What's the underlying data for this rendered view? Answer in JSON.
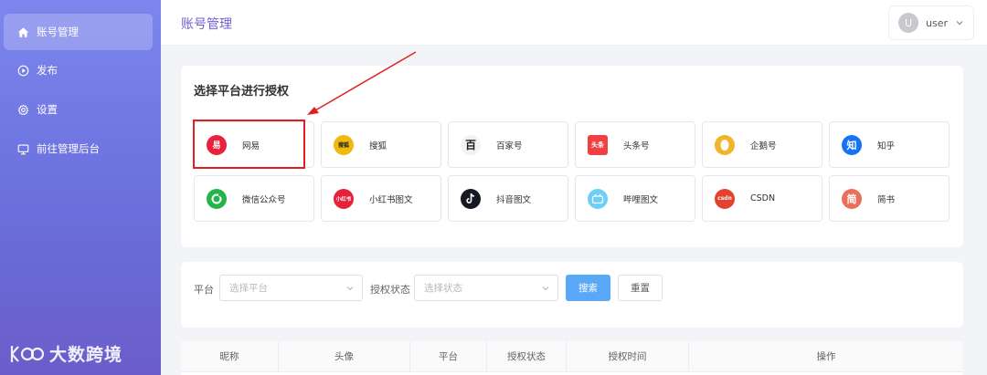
{
  "sidebar": {
    "items": [
      {
        "label": "账号管理",
        "icon": "home-icon",
        "active": true
      },
      {
        "label": "发布",
        "icon": "play-circle-icon",
        "active": false
      },
      {
        "label": "设置",
        "icon": "gear-icon",
        "active": false
      },
      {
        "label": "前往管理后台",
        "icon": "monitor-icon",
        "active": false
      }
    ],
    "watermark": "大数跨境"
  },
  "header": {
    "title": "账号管理",
    "user": {
      "avatar_letter": "U",
      "name": "user"
    }
  },
  "platforms": {
    "title": "选择平台进行授权",
    "items": [
      {
        "label": "网易",
        "icon_text": "易",
        "color": "#e8223a"
      },
      {
        "label": "搜狐",
        "icon_text": "搜狐",
        "color": "#f2b90f"
      },
      {
        "label": "百家号",
        "icon_text": "百",
        "color": "#f0f2f5"
      },
      {
        "label": "头条号",
        "icon_text": "头条",
        "color": "#f04142"
      },
      {
        "label": "企鹅号",
        "icon_text": "",
        "color": "#f0b52a"
      },
      {
        "label": "知乎",
        "icon_text": "知",
        "color": "#1772f6"
      },
      {
        "label": "微信公众号",
        "icon_text": "",
        "color": "#25b34b"
      },
      {
        "label": "小红书图文",
        "icon_text": "小红书",
        "color": "#e8213a"
      },
      {
        "label": "抖音图文",
        "icon_text": "",
        "color": "#161823"
      },
      {
        "label": "哔哩图文",
        "icon_text": "",
        "color": "#6ecff6"
      },
      {
        "label": "CSDN",
        "icon_text": "csdn",
        "color": "#e3422c"
      },
      {
        "label": "简书",
        "icon_text": "简",
        "color": "#ea6f5a"
      }
    ]
  },
  "filter": {
    "platform_label": "平台",
    "platform_placeholder": "选择平台",
    "status_label": "授权状态",
    "status_placeholder": "选择状态",
    "search_label": "搜索",
    "reset_label": "重置"
  },
  "table": {
    "columns": [
      "昵称",
      "头像",
      "平台",
      "授权状态",
      "授权时间",
      "操作"
    ]
  },
  "colors": {
    "accent": "#6f5fcf",
    "primary_button": "#5aa8f8",
    "highlight": "#e02020"
  }
}
